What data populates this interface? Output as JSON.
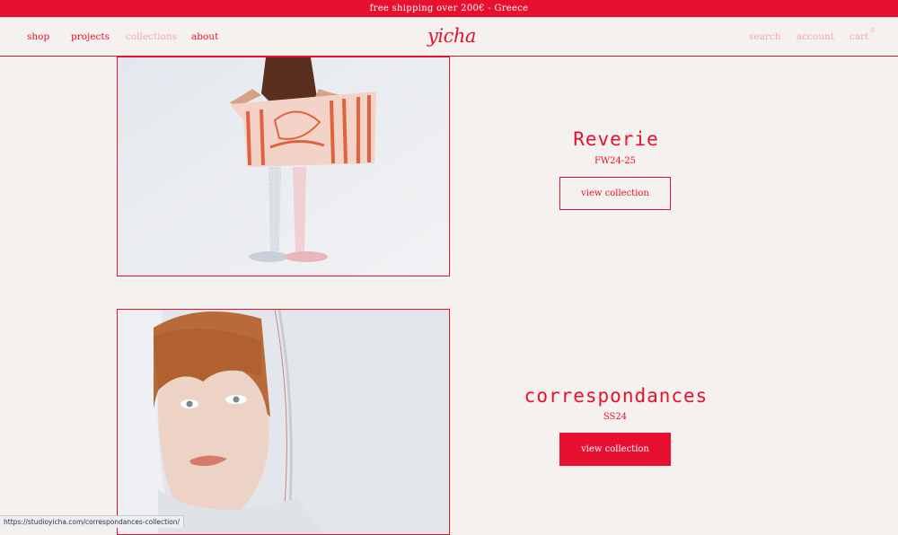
{
  "promo": {
    "text": "free shipping over 200€ - Greece"
  },
  "nav": {
    "left": [
      {
        "label": "shop",
        "muted": false
      },
      {
        "label": "projects",
        "muted": false
      },
      {
        "label": "collections",
        "muted": true
      },
      {
        "label": "about",
        "muted": false
      }
    ],
    "logo": "yicha",
    "right": {
      "search": "search",
      "account": "account",
      "cart": "cart",
      "cart_count": "0"
    }
  },
  "collections": [
    {
      "title": "Reverie",
      "season": "FW24-25",
      "button": "view collection",
      "button_style": "outline"
    },
    {
      "title": "correspondances",
      "season": "SS24",
      "button": "view collection",
      "button_style": "filled"
    }
  ],
  "status_bar": {
    "url": "https://studioyicha.com/correspondances-collection/"
  },
  "colors": {
    "accent": "#e8102f",
    "background": "#f5f1ee",
    "muted_link": "#f1a8b3"
  }
}
